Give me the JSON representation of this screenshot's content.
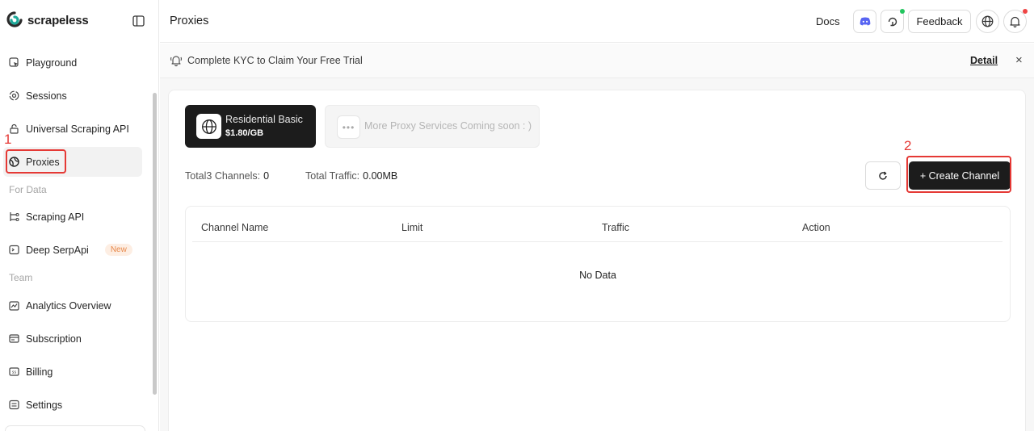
{
  "brand": {
    "name": "scrapeless",
    "accent": "#1fa99a"
  },
  "sidebar": {
    "items": [
      {
        "label": "Playground",
        "icon": "cursor-icon"
      },
      {
        "label": "Sessions",
        "icon": "sessions-icon"
      },
      {
        "label": "Universal Scraping API",
        "icon": "lock-icon"
      },
      {
        "label": "Proxies",
        "icon": "proxies-icon",
        "active": true
      },
      {
        "label": "Scraping API",
        "icon": "flow-icon"
      },
      {
        "label": "Deep SerpApi",
        "icon": "terminal-icon",
        "badge": "New"
      },
      {
        "label": "Analytics Overview",
        "icon": "analytics-icon"
      },
      {
        "label": "Subscription",
        "icon": "subscription-icon"
      },
      {
        "label": "Billing",
        "icon": "billing-icon"
      },
      {
        "label": "Settings",
        "icon": "settings-icon"
      }
    ],
    "sections": {
      "for_data": "For Data",
      "team": "Team"
    }
  },
  "annotations": {
    "one": "1",
    "two": "2",
    "color": "#e53935"
  },
  "header": {
    "title": "Proxies",
    "docs": "Docs",
    "feedback": "Feedback",
    "status_green": "#22c55e",
    "status_red": "#ef4444"
  },
  "kyc": {
    "text": "Complete KYC to Claim Your Free Trial",
    "detail": "Detail",
    "close": "×"
  },
  "services": {
    "active": {
      "name": "Residential Basic",
      "price": "$1.80/GB"
    },
    "soon": {
      "text": "More Proxy Services Coming soon : )"
    }
  },
  "stats": {
    "channels_label": "Total3 Channels:",
    "channels_value": "0",
    "traffic_label": "Total Traffic:",
    "traffic_value": "0.00MB"
  },
  "actions": {
    "create_channel": "+ Create Channel"
  },
  "table": {
    "columns": [
      "Channel Name",
      "Limit",
      "Traffic",
      "Action"
    ],
    "empty": "No Data"
  }
}
